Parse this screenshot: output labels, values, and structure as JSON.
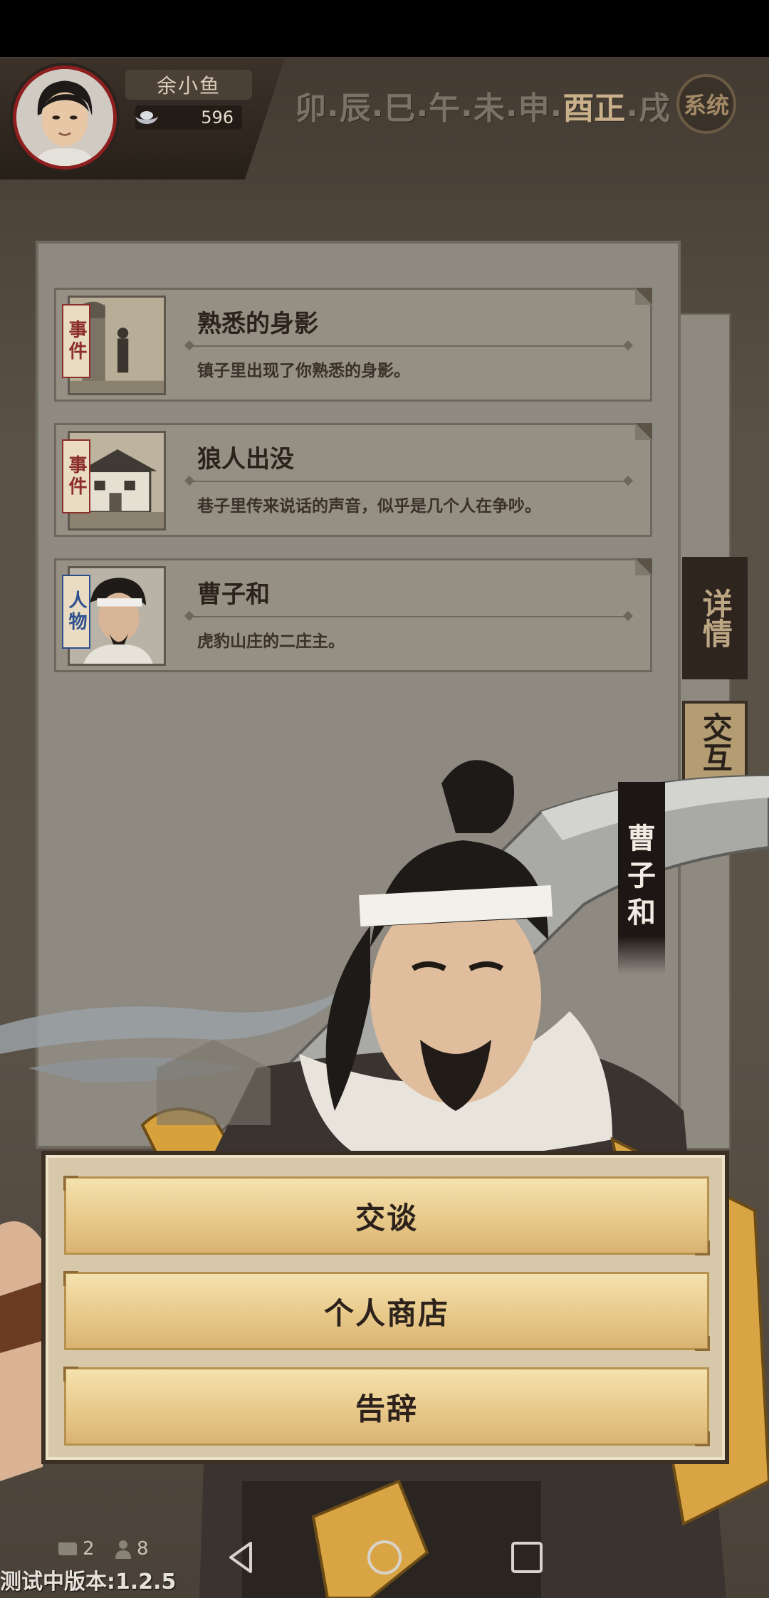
{
  "player": {
    "name": "余小鱼",
    "silver": "596"
  },
  "time_periods": [
    "卯",
    "辰",
    "巳",
    "午",
    "未",
    "申",
    "酉正",
    "戌"
  ],
  "system_button": "系统",
  "side_tabs": {
    "detail": "详情",
    "interact": "交互"
  },
  "cards": [
    {
      "badge": "事件",
      "title": "熟悉的身影",
      "desc": "镇子里出现了你熟悉的身影。"
    },
    {
      "badge": "事件",
      "title": "狼人出没",
      "desc": "巷子里传来说话的声音，似乎是几个人在争吵。"
    },
    {
      "badge": "人物",
      "title": "曹子和",
      "desc": "虎豹山庄的二庄主。"
    }
  ],
  "character_name": [
    "曹",
    "子",
    "和"
  ],
  "actions": [
    "交谈",
    "个人商店",
    "告辞"
  ],
  "bottom_stats": {
    "scrolls": "2",
    "people": "8"
  },
  "version": "测试中版本:1.2.5"
}
